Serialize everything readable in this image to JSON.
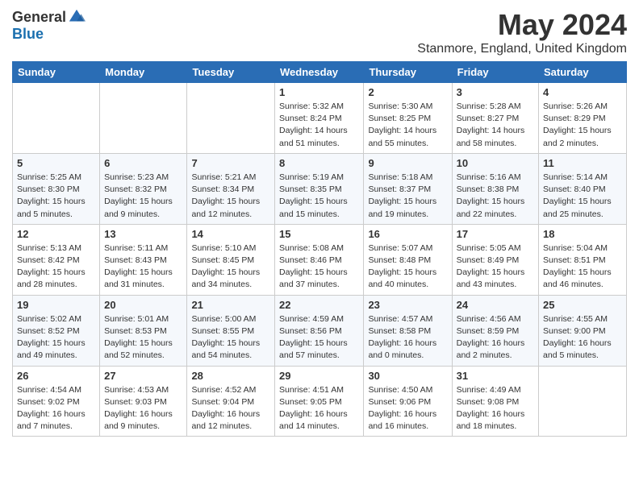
{
  "logo": {
    "general": "General",
    "blue": "Blue"
  },
  "title": "May 2024",
  "subtitle": "Stanmore, England, United Kingdom",
  "days": [
    "Sunday",
    "Monday",
    "Tuesday",
    "Wednesday",
    "Thursday",
    "Friday",
    "Saturday"
  ],
  "weeks": [
    [
      {
        "date": "",
        "info": ""
      },
      {
        "date": "",
        "info": ""
      },
      {
        "date": "",
        "info": ""
      },
      {
        "date": "1",
        "info": "Sunrise: 5:32 AM\nSunset: 8:24 PM\nDaylight: 14 hours\nand 51 minutes."
      },
      {
        "date": "2",
        "info": "Sunrise: 5:30 AM\nSunset: 8:25 PM\nDaylight: 14 hours\nand 55 minutes."
      },
      {
        "date": "3",
        "info": "Sunrise: 5:28 AM\nSunset: 8:27 PM\nDaylight: 14 hours\nand 58 minutes."
      },
      {
        "date": "4",
        "info": "Sunrise: 5:26 AM\nSunset: 8:29 PM\nDaylight: 15 hours\nand 2 minutes."
      }
    ],
    [
      {
        "date": "5",
        "info": "Sunrise: 5:25 AM\nSunset: 8:30 PM\nDaylight: 15 hours\nand 5 minutes."
      },
      {
        "date": "6",
        "info": "Sunrise: 5:23 AM\nSunset: 8:32 PM\nDaylight: 15 hours\nand 9 minutes."
      },
      {
        "date": "7",
        "info": "Sunrise: 5:21 AM\nSunset: 8:34 PM\nDaylight: 15 hours\nand 12 minutes."
      },
      {
        "date": "8",
        "info": "Sunrise: 5:19 AM\nSunset: 8:35 PM\nDaylight: 15 hours\nand 15 minutes."
      },
      {
        "date": "9",
        "info": "Sunrise: 5:18 AM\nSunset: 8:37 PM\nDaylight: 15 hours\nand 19 minutes."
      },
      {
        "date": "10",
        "info": "Sunrise: 5:16 AM\nSunset: 8:38 PM\nDaylight: 15 hours\nand 22 minutes."
      },
      {
        "date": "11",
        "info": "Sunrise: 5:14 AM\nSunset: 8:40 PM\nDaylight: 15 hours\nand 25 minutes."
      }
    ],
    [
      {
        "date": "12",
        "info": "Sunrise: 5:13 AM\nSunset: 8:42 PM\nDaylight: 15 hours\nand 28 minutes."
      },
      {
        "date": "13",
        "info": "Sunrise: 5:11 AM\nSunset: 8:43 PM\nDaylight: 15 hours\nand 31 minutes."
      },
      {
        "date": "14",
        "info": "Sunrise: 5:10 AM\nSunset: 8:45 PM\nDaylight: 15 hours\nand 34 minutes."
      },
      {
        "date": "15",
        "info": "Sunrise: 5:08 AM\nSunset: 8:46 PM\nDaylight: 15 hours\nand 37 minutes."
      },
      {
        "date": "16",
        "info": "Sunrise: 5:07 AM\nSunset: 8:48 PM\nDaylight: 15 hours\nand 40 minutes."
      },
      {
        "date": "17",
        "info": "Sunrise: 5:05 AM\nSunset: 8:49 PM\nDaylight: 15 hours\nand 43 minutes."
      },
      {
        "date": "18",
        "info": "Sunrise: 5:04 AM\nSunset: 8:51 PM\nDaylight: 15 hours\nand 46 minutes."
      }
    ],
    [
      {
        "date": "19",
        "info": "Sunrise: 5:02 AM\nSunset: 8:52 PM\nDaylight: 15 hours\nand 49 minutes."
      },
      {
        "date": "20",
        "info": "Sunrise: 5:01 AM\nSunset: 8:53 PM\nDaylight: 15 hours\nand 52 minutes."
      },
      {
        "date": "21",
        "info": "Sunrise: 5:00 AM\nSunset: 8:55 PM\nDaylight: 15 hours\nand 54 minutes."
      },
      {
        "date": "22",
        "info": "Sunrise: 4:59 AM\nSunset: 8:56 PM\nDaylight: 15 hours\nand 57 minutes."
      },
      {
        "date": "23",
        "info": "Sunrise: 4:57 AM\nSunset: 8:58 PM\nDaylight: 16 hours\nand 0 minutes."
      },
      {
        "date": "24",
        "info": "Sunrise: 4:56 AM\nSunset: 8:59 PM\nDaylight: 16 hours\nand 2 minutes."
      },
      {
        "date": "25",
        "info": "Sunrise: 4:55 AM\nSunset: 9:00 PM\nDaylight: 16 hours\nand 5 minutes."
      }
    ],
    [
      {
        "date": "26",
        "info": "Sunrise: 4:54 AM\nSunset: 9:02 PM\nDaylight: 16 hours\nand 7 minutes."
      },
      {
        "date": "27",
        "info": "Sunrise: 4:53 AM\nSunset: 9:03 PM\nDaylight: 16 hours\nand 9 minutes."
      },
      {
        "date": "28",
        "info": "Sunrise: 4:52 AM\nSunset: 9:04 PM\nDaylight: 16 hours\nand 12 minutes."
      },
      {
        "date": "29",
        "info": "Sunrise: 4:51 AM\nSunset: 9:05 PM\nDaylight: 16 hours\nand 14 minutes."
      },
      {
        "date": "30",
        "info": "Sunrise: 4:50 AM\nSunset: 9:06 PM\nDaylight: 16 hours\nand 16 minutes."
      },
      {
        "date": "31",
        "info": "Sunrise: 4:49 AM\nSunset: 9:08 PM\nDaylight: 16 hours\nand 18 minutes."
      },
      {
        "date": "",
        "info": ""
      }
    ]
  ]
}
